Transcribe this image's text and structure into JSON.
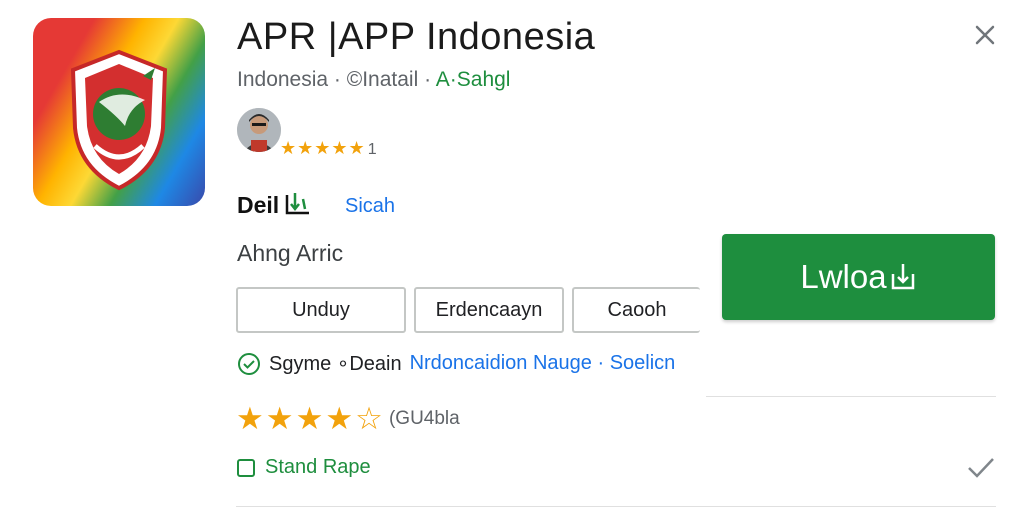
{
  "app": {
    "title": "APR |APP Indonesia",
    "subtitle": {
      "part1": "Indonesia · ",
      "part2": "©Inatail · ",
      "part3": "A·Sahgl"
    },
    "small_rating": {
      "stars": "★★★★★",
      "count": "1"
    }
  },
  "details": {
    "label": "Deil",
    "link": "Sicah"
  },
  "section": {
    "label": "Ahng Arric"
  },
  "chips": [
    "Unduy",
    "Erdencaayn",
    "Caooh"
  ],
  "download_button": {
    "label": "Lwloa"
  },
  "info": {
    "text": "Sgyme ∘Deain",
    "link": "Nrdoncaidion Nauge · Soelicn"
  },
  "rating": {
    "stars": "★★★★☆",
    "count": "(GU4bla"
  },
  "stand": {
    "label": "Stand Rape"
  },
  "colors": {
    "accent_green": "#1e8e3e",
    "link_blue": "#1a73e8",
    "star_orange": "#f2a20c"
  },
  "icons": {
    "close": "close-icon",
    "check_circle": "check-circle-icon",
    "checkmark": "checkmark-icon",
    "download": "download-icon"
  }
}
